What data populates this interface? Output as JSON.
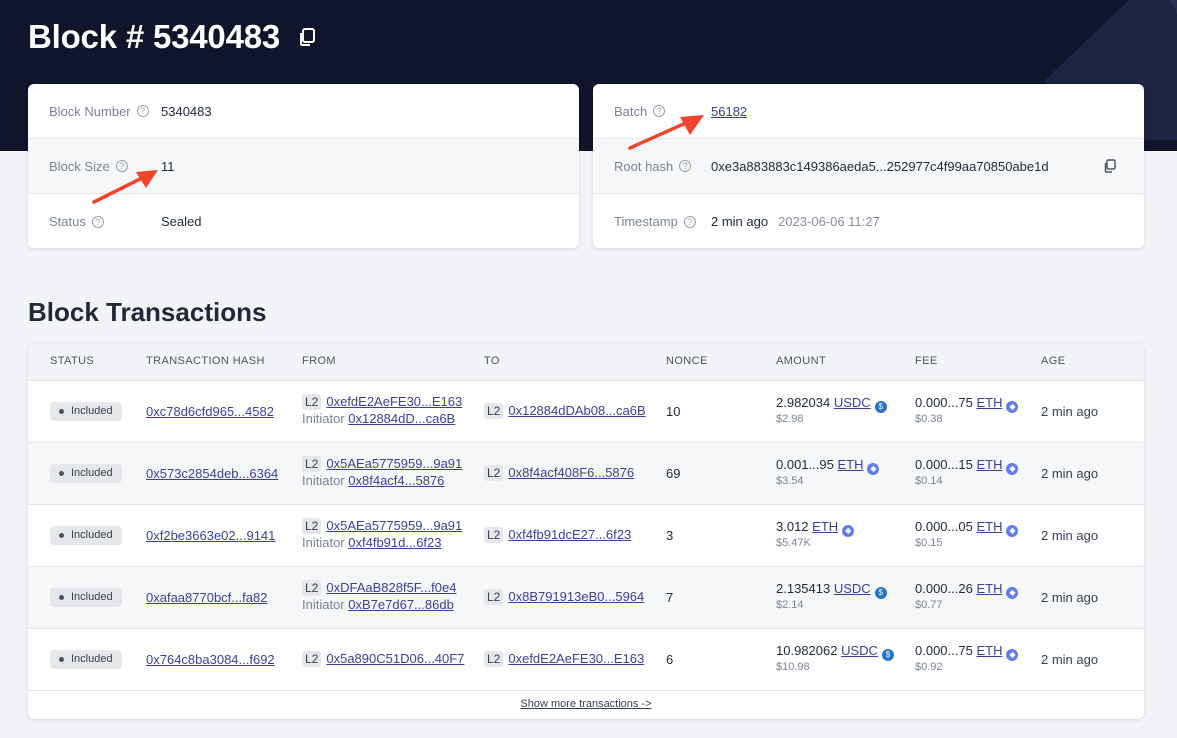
{
  "page": {
    "title": "Block # 5340483"
  },
  "block_info": {
    "block_number_label": "Block Number",
    "block_number": "5340483",
    "block_size_label": "Block Size",
    "block_size": "11",
    "status_label": "Status",
    "status": "Sealed",
    "batch_label": "Batch",
    "batch": "56182",
    "root_hash_label": "Root hash",
    "root_hash": "0xe3a883883c149386aeda5...252977c4f99aa70850abe1d",
    "timestamp_label": "Timestamp",
    "timestamp_relative": "2 min ago",
    "timestamp_absolute": "2023-06-06 11:27"
  },
  "transactions": {
    "title": "Block Transactions",
    "headers": [
      "STATUS",
      "TRANSACTION HASH",
      "FROM",
      "TO",
      "NONCE",
      "AMOUNT",
      "FEE",
      "AGE"
    ],
    "rows": [
      {
        "status": "Included",
        "hash": "0xc78d6cfd965...4582",
        "from_tag": "L2",
        "from": "0xefdE2AeFE30...E163",
        "initiator_label": "Initiator",
        "initiator": "0x12884dD...ca6B",
        "to_tag": "L2",
        "to": "0x12884dDAb08...ca6B",
        "nonce": "10",
        "amount": "2.982034",
        "amount_token": "USDC",
        "amount_usd": "$2.98",
        "fee": "0.000...75",
        "fee_token": "ETH",
        "fee_usd": "$0.38",
        "age": "2 min ago"
      },
      {
        "status": "Included",
        "hash": "0x573c2854deb...6364",
        "from_tag": "L2",
        "from": "0x5AEa5775959...9a91",
        "initiator_label": "Initiator",
        "initiator": "0x8f4acf4...5876",
        "to_tag": "L2",
        "to": "0x8f4acf408F6...5876",
        "nonce": "69",
        "amount": "0.001...95",
        "amount_token": "ETH",
        "amount_usd": "$3.54",
        "fee": "0.000...15",
        "fee_token": "ETH",
        "fee_usd": "$0.14",
        "age": "2 min ago"
      },
      {
        "status": "Included",
        "hash": "0xf2be3663e02...9141",
        "from_tag": "L2",
        "from": "0x5AEa5775959...9a91",
        "initiator_label": "Initiator",
        "initiator": "0xf4fb91d...6f23",
        "to_tag": "L2",
        "to": "0xf4fb91dcE27...6f23",
        "nonce": "3",
        "amount": "3.012",
        "amount_token": "ETH",
        "amount_usd": "$5.47K",
        "fee": "0.000...05",
        "fee_token": "ETH",
        "fee_usd": "$0.15",
        "age": "2 min ago"
      },
      {
        "status": "Included",
        "hash": "0xafaa8770bcf...fa82",
        "from_tag": "L2",
        "from": "0xDFAaB828f5F...f0e4",
        "initiator_label": "Initiator",
        "initiator": "0xB7e7d67...86db",
        "to_tag": "L2",
        "to": "0x8B791913eB0...5964",
        "nonce": "7",
        "amount": "2.135413",
        "amount_token": "USDC",
        "amount_usd": "$2.14",
        "fee": "0.000...26",
        "fee_token": "ETH",
        "fee_usd": "$0.77",
        "age": "2 min ago"
      },
      {
        "status": "Included",
        "hash": "0x764c8ba3084...f692",
        "from_tag": "L2",
        "from": "0x5a890C51D06...40F7",
        "to_tag": "L2",
        "to": "0xefdE2AeFE30...E163",
        "nonce": "6",
        "amount": "10.982062",
        "amount_token": "USDC",
        "amount_usd": "$10.98",
        "fee": "0.000...75",
        "fee_token": "ETH",
        "fee_usd": "$0.92",
        "age": "2 min ago"
      }
    ],
    "show_more": "Show more transactions ->"
  },
  "icons": {
    "copy": "copy-icon",
    "help": "help-icon",
    "usdc": "usdc-token-icon",
    "eth": "eth-token-icon"
  },
  "colors": {
    "header_bg": "#11152b",
    "link": "#3b3f9a",
    "arrow": "#f0442c"
  }
}
